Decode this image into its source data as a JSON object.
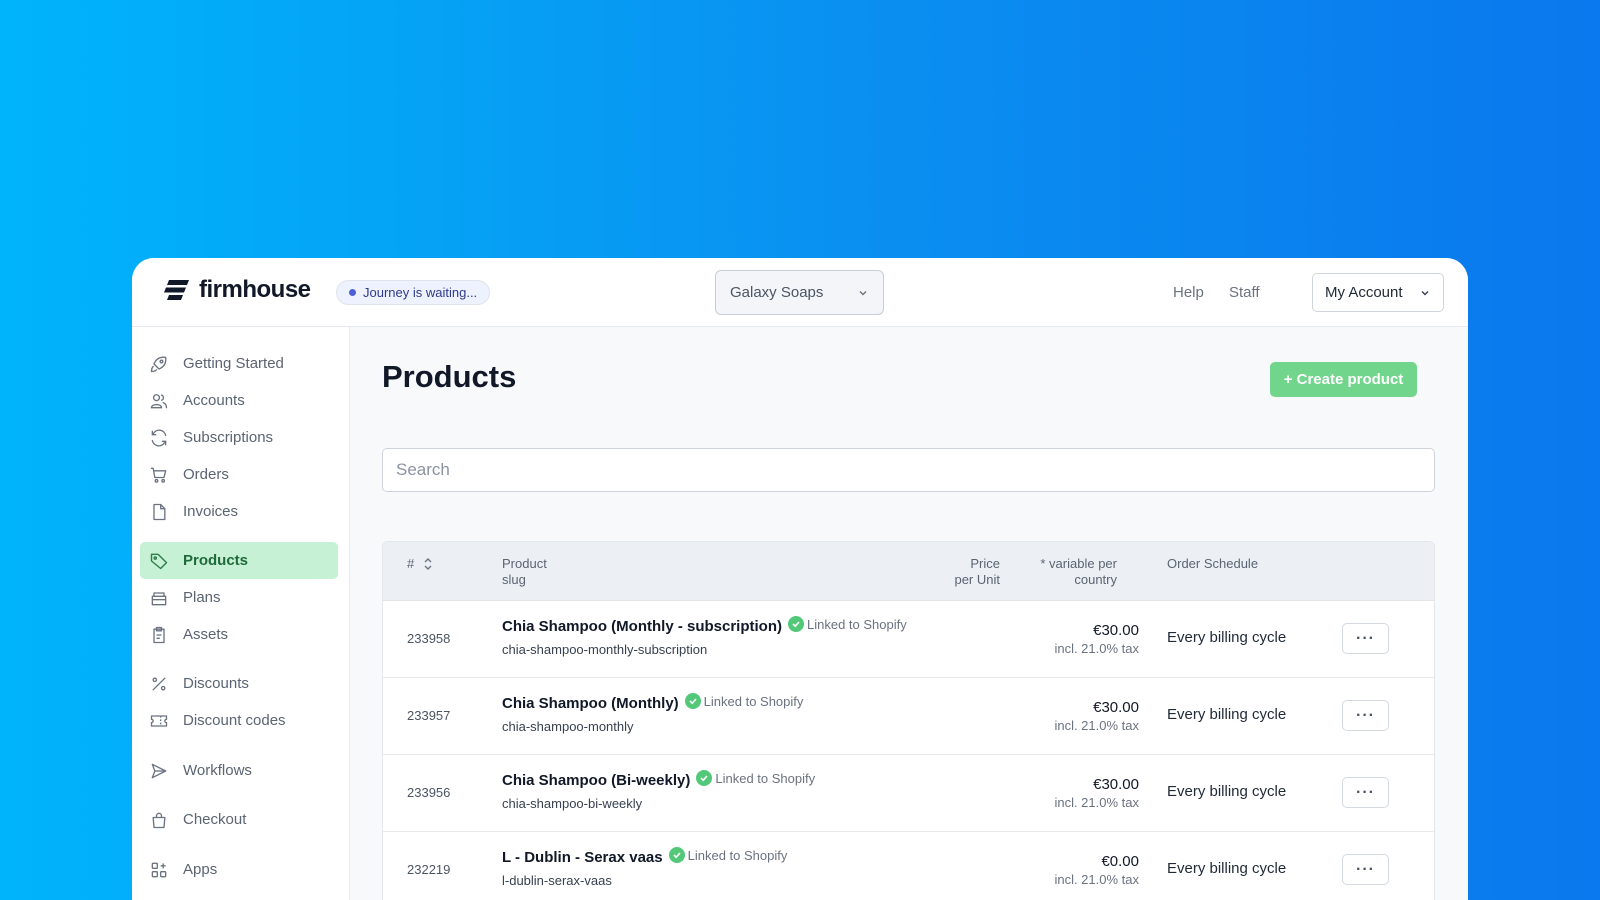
{
  "topbar": {
    "brand": "firmhouse",
    "journey_status": "Journey is waiting...",
    "store_select": "Galaxy Soaps",
    "help": "Help",
    "staff": "Staff",
    "account": "My Account"
  },
  "sidebar": {
    "items": [
      {
        "label": "Getting Started",
        "icon": "rocket-icon"
      },
      {
        "label": "Accounts",
        "icon": "users-icon"
      },
      {
        "label": "Subscriptions",
        "icon": "refresh-icon"
      },
      {
        "label": "Orders",
        "icon": "cart-icon"
      },
      {
        "label": "Invoices",
        "icon": "document-icon"
      },
      {
        "label": "Products",
        "icon": "tag-icon",
        "active": true
      },
      {
        "label": "Plans",
        "icon": "box-icon"
      },
      {
        "label": "Assets",
        "icon": "clipboard-icon"
      },
      {
        "label": "Discounts",
        "icon": "percent-icon"
      },
      {
        "label": "Discount codes",
        "icon": "ticket-icon"
      },
      {
        "label": "Workflows",
        "icon": "send-icon"
      },
      {
        "label": "Checkout",
        "icon": "bag-icon"
      },
      {
        "label": "Apps",
        "icon": "apps-icon"
      }
    ]
  },
  "main": {
    "title": "Products",
    "create_button": "+ Create product",
    "search_placeholder": "Search",
    "table": {
      "headers": {
        "id": "#",
        "product": "Product",
        "slug": "slug",
        "price": "Price",
        "per_unit": "per Unit",
        "variable": "* variable per",
        "country": "country",
        "schedule": "Order Schedule"
      },
      "rows": [
        {
          "id": "233958",
          "name": "Chia Shampoo (Monthly - subscription)",
          "linked": "Linked to Shopify",
          "slug": "chia-shampoo-monthly-subscription",
          "price": "€30.00",
          "tax": "incl. 21.0% tax",
          "schedule": "Every billing cycle"
        },
        {
          "id": "233957",
          "name": "Chia Shampoo (Monthly)",
          "linked": "Linked to Shopify",
          "slug": "chia-shampoo-monthly",
          "price": "€30.00",
          "tax": "incl. 21.0% tax",
          "schedule": "Every billing cycle"
        },
        {
          "id": "233956",
          "name": "Chia Shampoo (Bi-weekly)",
          "linked": "Linked to Shopify",
          "slug": "chia-shampoo-bi-weekly",
          "price": "€30.00",
          "tax": "incl. 21.0% tax",
          "schedule": "Every billing cycle"
        },
        {
          "id": "232219",
          "name": "L - Dublin - Serax vaas",
          "linked": "Linked to Shopify",
          "slug": "l-dublin-serax-vaas",
          "price": "€0.00",
          "tax": "incl. 21.0% tax",
          "schedule": "Every billing cycle"
        }
      ]
    }
  },
  "colors": {
    "background_start": "#00b4fb",
    "background_end": "#0a78ee",
    "accent_green": "#72d58c",
    "active_nav": "#c6f1d4",
    "linked_check": "#52c878"
  }
}
